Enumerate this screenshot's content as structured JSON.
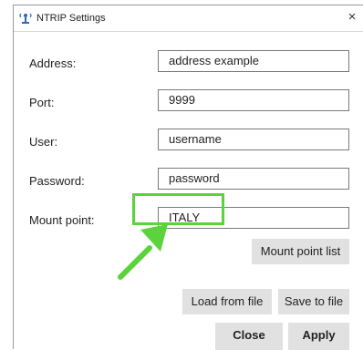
{
  "window": {
    "title": "NTRIP Settings",
    "close_glyph": "×"
  },
  "fields": {
    "address": {
      "label": "Address:",
      "value": "address example"
    },
    "port": {
      "label": "Port:",
      "value": "9999"
    },
    "user": {
      "label": "User:",
      "value": "username"
    },
    "password": {
      "label": "Password:",
      "value": "password"
    },
    "mount_point": {
      "label": "Mount point:",
      "value": "ITALY"
    }
  },
  "buttons": {
    "mount_point_list": "Mount point list",
    "load_from_file": "Load from file",
    "save_to_file": "Save to file",
    "close": "Close",
    "apply": "Apply"
  },
  "colors": {
    "highlight": "#5bd33a",
    "button_bg": "#e1e1e1"
  },
  "icons": {
    "app": "ntrip-antenna-icon",
    "annotation": "green-arrow-icon"
  }
}
